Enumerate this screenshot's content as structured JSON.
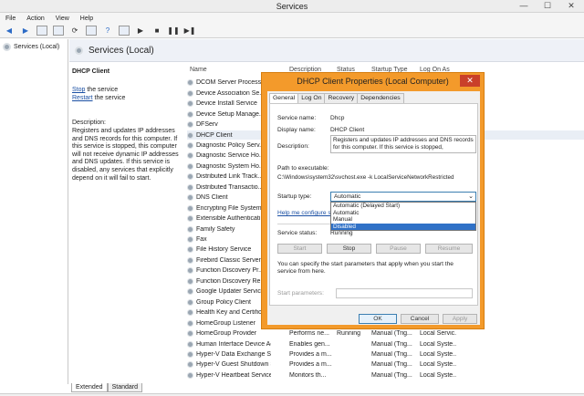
{
  "window": {
    "title": "Services",
    "min": "—",
    "max": "☐",
    "close": "✕"
  },
  "menu": [
    "File",
    "Action",
    "View",
    "Help"
  ],
  "tree": {
    "item": "Services (Local)"
  },
  "header": {
    "title": "Services (Local)"
  },
  "left_panel": {
    "service_title": "DHCP Client",
    "stop_link": "Stop",
    "stop_rest": " the service",
    "restart_link": "Restart",
    "restart_rest": " the service",
    "description_heading": "Description:",
    "description": "Registers and updates IP addresses and DNS records for this computer. If this service is stopped, this computer will not receive dynamic IP addresses and DNS updates. If this service is disabled, any services that explicitly depend on it will fail to start."
  },
  "list": {
    "columns": {
      "name": "Name",
      "description": "Description",
      "status": "Status",
      "startup": "Startup Type",
      "logon": "Log On As"
    },
    "rows": [
      {
        "name": "DCOM Server Process...",
        "description": "",
        "status": "",
        "startup": "",
        "logon": ""
      },
      {
        "name": "Device Association Se...",
        "description": "",
        "status": "",
        "startup": "",
        "logon": ""
      },
      {
        "name": "Device Install Service",
        "description": "",
        "status": "",
        "startup": "",
        "logon": ""
      },
      {
        "name": "Device Setup Manage...",
        "description": "",
        "status": "",
        "startup": "",
        "logon": ""
      },
      {
        "name": "DFServ",
        "description": "",
        "status": "",
        "startup": "",
        "logon": ""
      },
      {
        "name": "DHCP Client",
        "description": "",
        "status": "",
        "startup": "",
        "logon": ""
      },
      {
        "name": "Diagnostic Policy Serv...",
        "description": "",
        "status": "",
        "startup": "",
        "logon": ""
      },
      {
        "name": "Diagnostic Service Ho...",
        "description": "",
        "status": "",
        "startup": "",
        "logon": ""
      },
      {
        "name": "Diagnostic System Ho...",
        "description": "",
        "status": "",
        "startup": "",
        "logon": ""
      },
      {
        "name": "Distributed Link Track...",
        "description": "",
        "status": "",
        "startup": "",
        "logon": ""
      },
      {
        "name": "Distributed Transactio...",
        "description": "",
        "status": "",
        "startup": "",
        "logon": ""
      },
      {
        "name": "DNS Client",
        "description": "",
        "status": "",
        "startup": "",
        "logon": ""
      },
      {
        "name": "Encrypting File System...",
        "description": "",
        "status": "",
        "startup": "",
        "logon": ""
      },
      {
        "name": "Extensible Authenticati...",
        "description": "",
        "status": "",
        "startup": "",
        "logon": ""
      },
      {
        "name": "Family Safety",
        "description": "",
        "status": "",
        "startup": "",
        "logon": ""
      },
      {
        "name": "Fax",
        "description": "",
        "status": "",
        "startup": "",
        "logon": ""
      },
      {
        "name": "File History Service",
        "description": "",
        "status": "",
        "startup": "",
        "logon": ""
      },
      {
        "name": "Firebird Classic Server...",
        "description": "",
        "status": "",
        "startup": "",
        "logon": ""
      },
      {
        "name": "Function Discovery Pr...",
        "description": "",
        "status": "",
        "startup": "",
        "logon": ""
      },
      {
        "name": "Function Discovery Re...",
        "description": "",
        "status": "",
        "startup": "",
        "logon": ""
      },
      {
        "name": "Google Updater Servic...",
        "description": "",
        "status": "",
        "startup": "",
        "logon": ""
      },
      {
        "name": "Group Policy Client",
        "description": "",
        "status": "",
        "startup": "",
        "logon": ""
      },
      {
        "name": "Health Key and Certific...",
        "description": "",
        "status": "",
        "startup": "",
        "logon": ""
      },
      {
        "name": "HomeGroup Listener",
        "description": "",
        "status": "",
        "startup": "",
        "logon": ""
      },
      {
        "name": "HomeGroup Provider",
        "description": "Performs ne...",
        "status": "Running",
        "startup": "Manual (Trig...",
        "logon": "Local Servic..."
      },
      {
        "name": "Human Interface Device Ac...",
        "description": "Enables gen...",
        "status": "",
        "startup": "Manual (Trig...",
        "logon": "Local Syste..."
      },
      {
        "name": "Hyper-V Data Exchange Ser...",
        "description": "Provides a m...",
        "status": "",
        "startup": "Manual (Trig...",
        "logon": "Local Syste..."
      },
      {
        "name": "Hyper-V Guest Shutdown S...",
        "description": "Provides a m...",
        "status": "",
        "startup": "Manual (Trig...",
        "logon": "Local Syste..."
      },
      {
        "name": "Hyper-V Heartbeat Service",
        "description": "Monitors th...",
        "status": "",
        "startup": "Manual (Trig...",
        "logon": "Local Syste..."
      }
    ]
  },
  "bottom_tabs": {
    "extended": "Extended",
    "standard": "Standard"
  },
  "dialog": {
    "title": "DHCP Client Properties (Local Computer)",
    "close": "✕",
    "tabs": [
      "General",
      "Log On",
      "Recovery",
      "Dependencies"
    ],
    "service_name_label": "Service name:",
    "service_name": "Dhcp",
    "display_name_label": "Display name:",
    "display_name": "DHCP Client",
    "description_label": "Description:",
    "description": "Registers and updates IP addresses and DNS records for this computer. If this service is stopped,",
    "path_label": "Path to executable:",
    "path": "C:\\Windows\\system32\\svchost.exe -k LocalServiceNetworkRestricted",
    "startup_label": "Startup type:",
    "startup_value": "Automatic",
    "startup_options": [
      "Automatic (Delayed Start)",
      "Automatic",
      "Manual",
      "Disabled"
    ],
    "help_link": "Help me configure s",
    "status_label": "Service status:",
    "status_value": "Running",
    "buttons": {
      "start": "Start",
      "stop": "Stop",
      "pause": "Pause",
      "resume": "Resume"
    },
    "params_note": "You can specify the start parameters that apply when you start the service from here.",
    "params_label": "Start parameters:",
    "ok": "OK",
    "cancel": "Cancel",
    "apply": "Apply"
  },
  "colors": {
    "dialog_frame": "#f39a2b",
    "selection": "#3071c7",
    "link": "#1a4fa3"
  }
}
